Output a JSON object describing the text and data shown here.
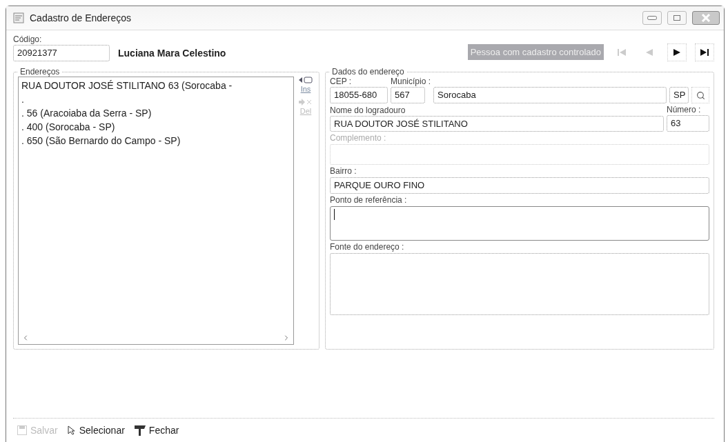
{
  "window": {
    "title": "Cadastro de Endereços"
  },
  "header": {
    "code_label": "Código:",
    "code_value": "20921377",
    "person_name": "Luciana Mara Celestino",
    "status_badge": "Pessoa com cadastro controlado",
    "nav_buttons": [
      {
        "kind": "first",
        "disabled": true
      },
      {
        "kind": "prev",
        "disabled": true
      },
      {
        "kind": "next",
        "disabled": false
      },
      {
        "kind": "last",
        "disabled": false
      }
    ]
  },
  "addresses": {
    "title": "Endereços",
    "items": [
      {
        "text": "RUA DOUTOR JOSÉ STILITANO 63 (Sorocaba -",
        "selected": false
      },
      {
        "text": ".",
        "selected": false
      },
      {
        "text": ". 56 (Aracoiaba da Serra - SP)",
        "selected": false
      },
      {
        "text": ". 400 (Sorocaba - SP)",
        "selected": false
      },
      {
        "text": ". 650 (São Bernardo do Campo - SP)",
        "selected": false
      }
    ],
    "side_buttons": [
      {
        "kind": "insert",
        "label": "Ins",
        "disabled": false
      },
      {
        "kind": "delete",
        "label": "Del",
        "disabled": true
      }
    ]
  },
  "details": {
    "title": "Dados do endereço",
    "cep": {
      "label": "CEP :",
      "value": "18055-680"
    },
    "municipio": {
      "label": "Município :",
      "code": "567",
      "name": "Sorocaba",
      "uf": "SP"
    },
    "logradouro": {
      "label": "Nome do logradouro",
      "value": "RUA DOUTOR JOSÉ STILITANO"
    },
    "numero": {
      "label": "Número :",
      "value": "63"
    },
    "complemento": {
      "label": "Complemento :",
      "disabled": true
    },
    "bairro": {
      "label": "Bairro :",
      "value": "PARQUE OURO FINO"
    },
    "referencia": {
      "label": "Ponto de referência :",
      "focused": true
    },
    "fonte": {
      "label": "Fonte do endereço :"
    }
  },
  "toolbar": [
    {
      "kind": "save",
      "label": "Salvar",
      "disabled": true
    },
    {
      "kind": "select",
      "label": "Selecionar",
      "disabled": false
    },
    {
      "kind": "close",
      "label": "Fechar",
      "disabled": false
    }
  ]
}
